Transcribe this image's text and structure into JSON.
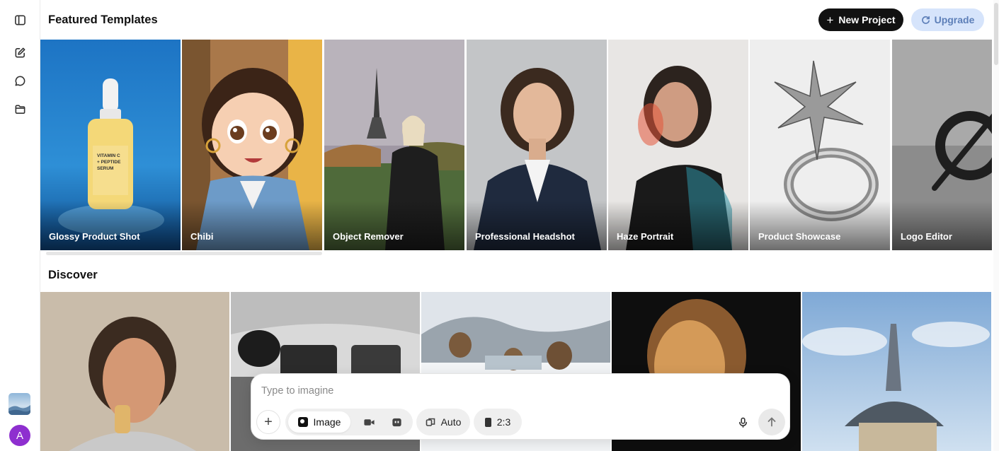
{
  "header": {
    "featured_title": "Featured Templates",
    "new_project_label": "New Project",
    "upgrade_label": "Upgrade"
  },
  "sidebar": {
    "items": [
      {
        "icon": "sidebar-toggle-icon"
      },
      {
        "icon": "edit-icon"
      },
      {
        "icon": "chat-icon"
      },
      {
        "icon": "folder-icon"
      }
    ],
    "avatar_letter": "A",
    "avatar_color": "#8e2fcf"
  },
  "templates": [
    {
      "label": "Glossy Product Shot"
    },
    {
      "label": "Chibi"
    },
    {
      "label": "Object Remover"
    },
    {
      "label": "Professional Headshot"
    },
    {
      "label": "Haze Portrait"
    },
    {
      "label": "Product Showcase"
    },
    {
      "label": "Logo Editor"
    }
  ],
  "discover": {
    "title": "Discover"
  },
  "composer": {
    "placeholder": "Type to imagine",
    "mode_image_label": "Image",
    "auto_label": "Auto",
    "ratio_label": "2:3"
  },
  "product_label": {
    "line1": "VITAMIN C",
    "line2": "+ PEPTIDE",
    "line3": "SERUM"
  }
}
